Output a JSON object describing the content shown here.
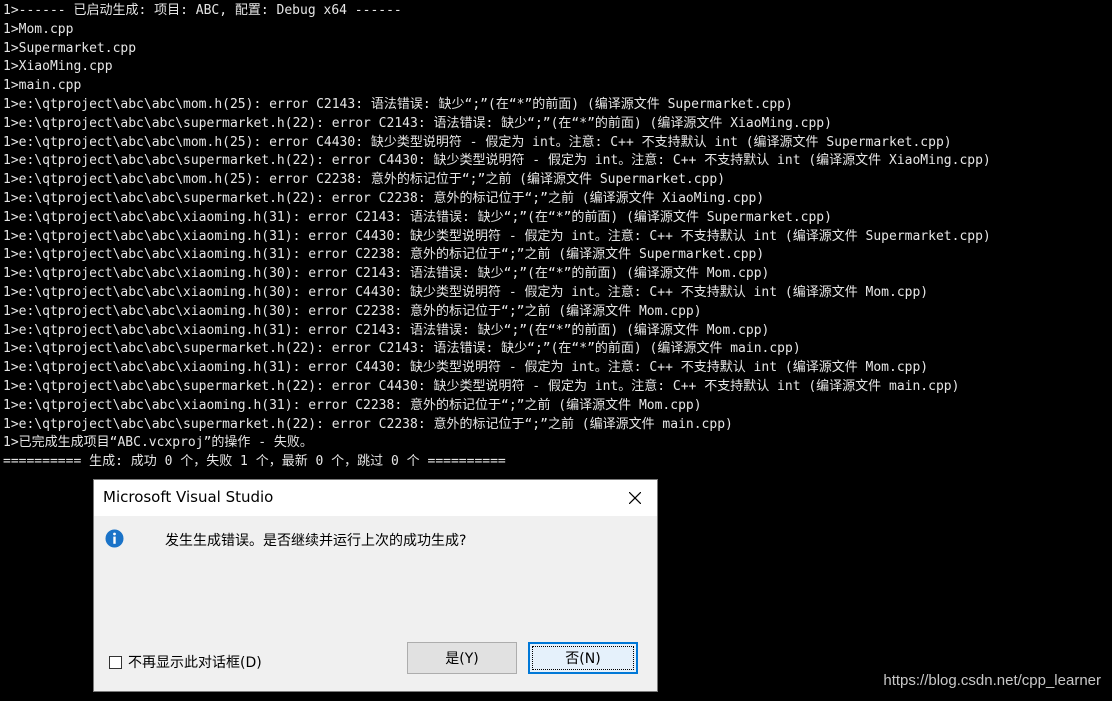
{
  "output": {
    "lines": [
      "1>------ 已启动生成: 项目: ABC, 配置: Debug x64 ------",
      "1>Mom.cpp",
      "1>Supermarket.cpp",
      "1>XiaoMing.cpp",
      "1>main.cpp",
      "1>e:\\qtproject\\abc\\abc\\mom.h(25): error C2143: 语法错误: 缺少“;”(在“*”的前面) (编译源文件 Supermarket.cpp)",
      "1>e:\\qtproject\\abc\\abc\\supermarket.h(22): error C2143: 语法错误: 缺少“;”(在“*”的前面) (编译源文件 XiaoMing.cpp)",
      "1>e:\\qtproject\\abc\\abc\\mom.h(25): error C4430: 缺少类型说明符 - 假定为 int。注意: C++ 不支持默认 int (编译源文件 Supermarket.cpp)",
      "1>e:\\qtproject\\abc\\abc\\supermarket.h(22): error C4430: 缺少类型说明符 - 假定为 int。注意: C++ 不支持默认 int (编译源文件 XiaoMing.cpp)",
      "1>e:\\qtproject\\abc\\abc\\mom.h(25): error C2238: 意外的标记位于“;”之前 (编译源文件 Supermarket.cpp)",
      "1>e:\\qtproject\\abc\\abc\\supermarket.h(22): error C2238: 意外的标记位于“;”之前 (编译源文件 XiaoMing.cpp)",
      "1>e:\\qtproject\\abc\\abc\\xiaoming.h(31): error C2143: 语法错误: 缺少“;”(在“*”的前面) (编译源文件 Supermarket.cpp)",
      "1>e:\\qtproject\\abc\\abc\\xiaoming.h(31): error C4430: 缺少类型说明符 - 假定为 int。注意: C++ 不支持默认 int (编译源文件 Supermarket.cpp)",
      "1>e:\\qtproject\\abc\\abc\\xiaoming.h(31): error C2238: 意外的标记位于“;”之前 (编译源文件 Supermarket.cpp)",
      "1>e:\\qtproject\\abc\\abc\\xiaoming.h(30): error C2143: 语法错误: 缺少“;”(在“*”的前面) (编译源文件 Mom.cpp)",
      "1>e:\\qtproject\\abc\\abc\\xiaoming.h(30): error C4430: 缺少类型说明符 - 假定为 int。注意: C++ 不支持默认 int (编译源文件 Mom.cpp)",
      "1>e:\\qtproject\\abc\\abc\\xiaoming.h(30): error C2238: 意外的标记位于“;”之前 (编译源文件 Mom.cpp)",
      "1>e:\\qtproject\\abc\\abc\\xiaoming.h(31): error C2143: 语法错误: 缺少“;”(在“*”的前面) (编译源文件 Mom.cpp)",
      "1>e:\\qtproject\\abc\\abc\\supermarket.h(22): error C2143: 语法错误: 缺少“;”(在“*”的前面) (编译源文件 main.cpp)",
      "1>e:\\qtproject\\abc\\abc\\xiaoming.h(31): error C4430: 缺少类型说明符 - 假定为 int。注意: C++ 不支持默认 int (编译源文件 Mom.cpp)",
      "1>e:\\qtproject\\abc\\abc\\supermarket.h(22): error C4430: 缺少类型说明符 - 假定为 int。注意: C++ 不支持默认 int (编译源文件 main.cpp)",
      "1>e:\\qtproject\\abc\\abc\\xiaoming.h(31): error C2238: 意外的标记位于“;”之前 (编译源文件 Mom.cpp)",
      "1>e:\\qtproject\\abc\\abc\\supermarket.h(22): error C2238: 意外的标记位于“;”之前 (编译源文件 main.cpp)",
      "1>已完成生成项目“ABC.vcxproj”的操作 - 失败。",
      "========== 生成: 成功 0 个，失败 1 个，最新 0 个，跳过 0 个 =========="
    ]
  },
  "dialog": {
    "title": "Microsoft Visual Studio",
    "message": "发生生成错误。是否继续并运行上次的成功生成?",
    "yes_label": "是(Y)",
    "no_label": "否(N)",
    "checkbox_label": "不再显示此对话框(D)",
    "checkbox_checked": false,
    "icon": "info-icon",
    "close_icon": "close-icon"
  },
  "watermark": {
    "text": "https://blog.csdn.net/cpp_learner"
  },
  "colors": {
    "console_bg": "#000000",
    "console_text": "#e6e6e6",
    "info_blue": "#1a73c8",
    "focus_border": "#0078d7"
  }
}
